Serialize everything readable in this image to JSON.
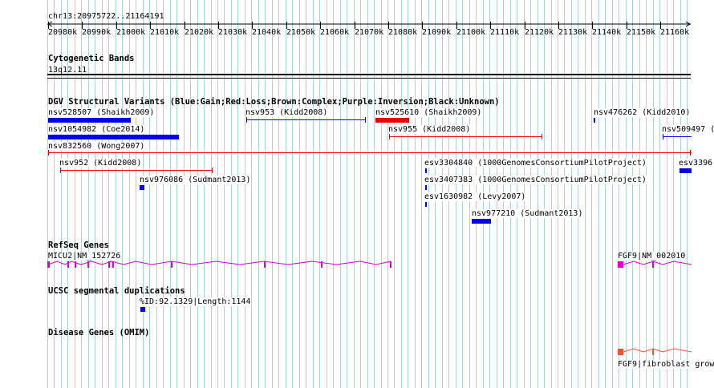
{
  "ruler": {
    "region": "chr13:20975722..21164191",
    "ticks": [
      "20980k",
      "20990k",
      "21000k",
      "21010k",
      "21020k",
      "21030k",
      "21040k",
      "21050k",
      "21060k",
      "21070k",
      "21080k",
      "21090k",
      "21100k",
      "21110k",
      "21120k",
      "21130k",
      "21140k",
      "21150k",
      "21160k"
    ]
  },
  "tracks": {
    "cytoband": {
      "title": "Cytogenetic Bands",
      "band": "13q12.11"
    },
    "dgv": {
      "title": "DGV Structural Variants (Blue:Gain;Red:Loss;Brown:Complex;Purple:Inversion;Black:Unknown)",
      "features": [
        {
          "label": "nsv528507 (Shaikh2009)",
          "type": "Gain"
        },
        {
          "label": "nsv953 (Kidd2008)",
          "type": "Gain"
        },
        {
          "label": "nsv525610 (Shaikh2009)",
          "type": "Loss"
        },
        {
          "label": "nsv476262 (Kidd2010)",
          "type": "Gain"
        },
        {
          "label": "nsv1054982 (Coe2014)",
          "type": "Gain"
        },
        {
          "label": "nsv955 (Kidd2008)",
          "type": "Loss"
        },
        {
          "label": "nsv509497 (",
          "type": "Gain"
        },
        {
          "label": "nsv832560 (Wong2007)",
          "type": "Loss"
        },
        {
          "label": "nsv952 (Kidd2008)",
          "type": "Loss"
        },
        {
          "label": "esv3304840 (1000GenomesConsortiumPilotProject)",
          "type": "Gain"
        },
        {
          "label": "esv3396",
          "type": "Gain"
        },
        {
          "label": "nsv976086 (Sudmant2013)",
          "type": "Gain"
        },
        {
          "label": "esv3407383 (1000GenomesConsortiumPilotProject)",
          "type": "Gain"
        },
        {
          "label": "esv1630982 (Levy2007)",
          "type": "Gain"
        },
        {
          "label": "nsv977210 (Sudmant2013)",
          "type": "Gain"
        }
      ]
    },
    "refseq": {
      "title": "RefSeq Genes",
      "genes": [
        {
          "label": "MICU2|NM_152726"
        },
        {
          "label": "FGF9|NM_002010"
        }
      ]
    },
    "segdup": {
      "title": "UCSC segmental duplications",
      "label": "%ID:92.1329|Length:1144"
    },
    "omim": {
      "title": "Disease Genes (OMIM)",
      "label": "FGF9|fibroblast grow"
    }
  },
  "colors": {
    "gain": "#0000ee",
    "loss": "#ee0000",
    "gene": "#d600d6",
    "omim": "#ee5533",
    "grid": "#a8d4e0"
  }
}
